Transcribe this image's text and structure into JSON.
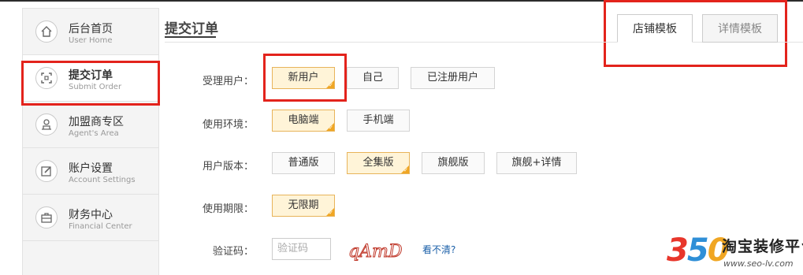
{
  "sidebar": {
    "items": [
      {
        "zh": "后台首页",
        "en": "User Home",
        "icon": "home-icon"
      },
      {
        "zh": "提交订单",
        "en": "Submit Order",
        "icon": "order-icon"
      },
      {
        "zh": "加盟商专区",
        "en": "Agent's Area",
        "icon": "agent-icon"
      },
      {
        "zh": "账户设置",
        "en": "Account Settings",
        "icon": "edit-icon"
      },
      {
        "zh": "财务中心",
        "en": "Financial Center",
        "icon": "briefcase-icon"
      }
    ]
  },
  "header": {
    "title": "提交订单",
    "tabs": [
      {
        "label": "店铺模板"
      },
      {
        "label": "详情模板"
      }
    ]
  },
  "form": {
    "user": {
      "label": "受理用户：",
      "options": [
        "新用户",
        "自己",
        "已注册用户"
      ],
      "selected": "新用户"
    },
    "env": {
      "label": "使用环境：",
      "options": [
        "电脑端",
        "手机端"
      ],
      "selected": "电脑端"
    },
    "version": {
      "label": "用户版本：",
      "options": [
        "普通版",
        "全集版",
        "旗舰版",
        "旗舰+详情"
      ],
      "selected": "全集版"
    },
    "period": {
      "label": "使用期限：",
      "options": [
        "无限期"
      ],
      "selected": "无限期"
    },
    "captcha": {
      "label": "验证码：",
      "placeholder": "验证码",
      "image_text": "qAmD",
      "refresh": "看不清?"
    }
  },
  "watermark": {
    "digit1": "3",
    "digit2": "5",
    "digit3": "0",
    "brand": "淘宝装修平台",
    "url": "www.seo-lv.com"
  },
  "colors": {
    "accent_selected": "#f0a623",
    "highlight_red": "#e3231c",
    "link": "#1a5fa8"
  }
}
